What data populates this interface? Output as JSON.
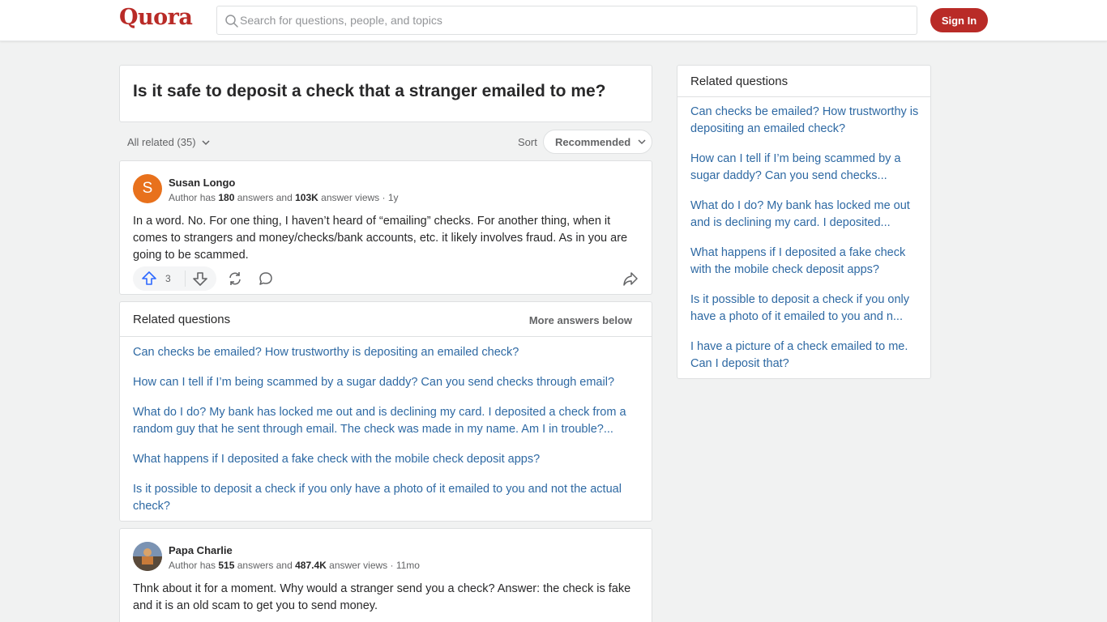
{
  "header": {
    "logo": "Quora",
    "search_placeholder": "Search for questions, people, and topics",
    "signin_label": "Sign In"
  },
  "question": {
    "title": "Is it safe to deposit a check that a stranger emailed to me?"
  },
  "filter": {
    "all_related": "All related (35)",
    "sort_label": "Sort",
    "sort_value": "Recommended"
  },
  "answers": [
    {
      "avatar_letter": "S",
      "author": "Susan Longo",
      "cred_prefix": "Author has ",
      "answers_count": "180",
      "cred_mid": " answers and ",
      "views": "103K",
      "cred_suffix": " answer views · 1y",
      "text": "In a word. No. For one thing, I haven’t heard of “emailing” checks. For another thing, when it comes to strangers and money/checks/bank accounts, etc. it likely involves fraud. As in you are going to be scammed.",
      "upvotes": "3"
    },
    {
      "author": "Papa Charlie",
      "cred_prefix": "Author has ",
      "answers_count": "515",
      "cred_mid": " answers and ",
      "views": "487.4K",
      "cred_suffix": " answer views · 11mo",
      "text": "Thnk about it for a moment. Why would a stranger send you a check? Answer: the check is fake and it is an old scam to get you to send money."
    }
  ],
  "related_inline": {
    "title": "Related questions",
    "more": "More answers below",
    "items": [
      "Can checks be emailed? How trustworthy is depositing an emailed check?",
      "How can I tell if I’m being scammed by a sugar daddy? Can you send checks through email?",
      "What do I do? My bank has locked me out and is declining my card. I deposited a check from a random guy that he sent through email. The check was made in my name. Am I in trouble?...",
      "What happens if I deposited a fake check with the mobile check deposit apps?",
      "Is it possible to deposit a check if you only have a photo of it emailed to you and not the actual check?"
    ]
  },
  "related_side": {
    "title": "Related questions",
    "items": [
      "Can checks be emailed? How trustworthy is depositing an emailed check?",
      "How can I tell if I’m being scammed by a sugar daddy? Can you send checks...",
      "What do I do? My bank has locked me out and is declining my card. I deposited...",
      "What happens if I deposited a fake check with the mobile check deposit apps?",
      "Is it possible to deposit a check if you only have a photo of it emailed to you and n...",
      "I have a picture of a check emailed to me. Can I deposit that?"
    ]
  },
  "colors": {
    "brand": "#b92b27",
    "link": "#2e69a3"
  }
}
